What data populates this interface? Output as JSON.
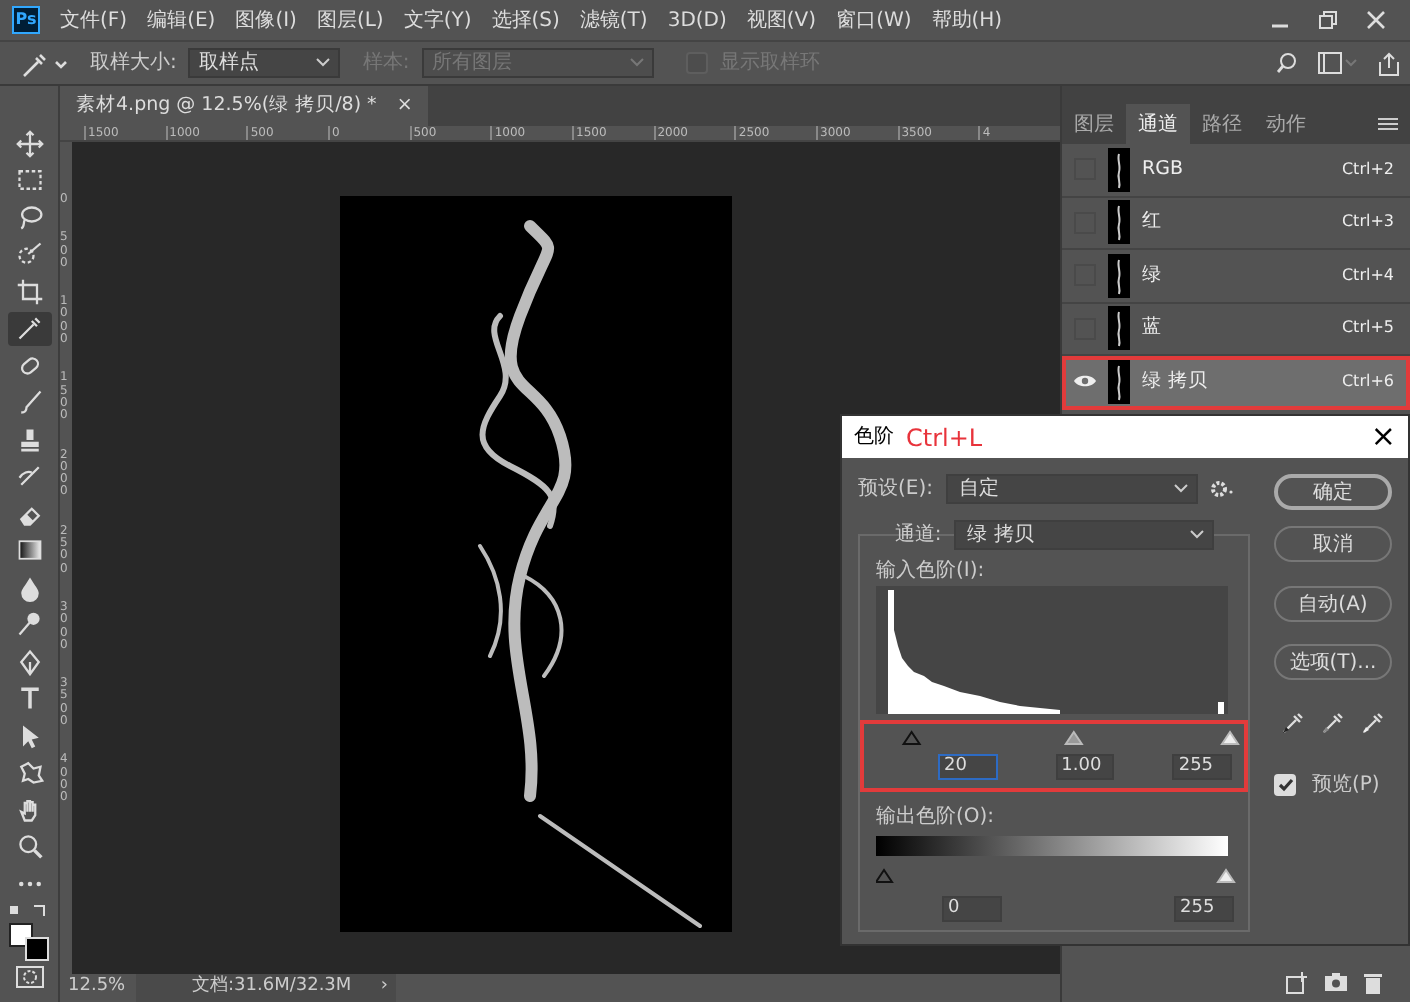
{
  "menu_bar": {
    "logo": "Ps",
    "items": [
      "文件(F)",
      "编辑(E)",
      "图像(I)",
      "图层(L)",
      "文字(Y)",
      "选择(S)",
      "滤镜(T)",
      "3D(D)",
      "视图(V)",
      "窗口(W)",
      "帮助(H)"
    ]
  },
  "options_bar": {
    "sample_size_label": "取样大小:",
    "sample_size": "取样点",
    "sample_label": "样本:",
    "sample": "所有图层",
    "sample_disabled": true,
    "ring_label": "显示取样环",
    "ring_checked": false,
    "ring_disabled": true
  },
  "document_tab": {
    "title": "素材4.png @ 12.5%(绿 拷贝/8) *",
    "close": "×"
  },
  "rulers": {
    "horizontal": [
      "1500",
      "1000",
      "500",
      "0",
      "500",
      "1000",
      "1500",
      "2000",
      "2500",
      "3000",
      "3500",
      "4"
    ],
    "vertical": [
      "0",
      "500",
      "1000",
      "1500",
      "2000",
      "2500",
      "3000",
      "3500",
      "4000"
    ]
  },
  "tools": [
    {
      "kind": "move",
      "selected": false
    },
    {
      "kind": "marquee",
      "selected": false
    },
    {
      "kind": "lasso",
      "selected": false
    },
    {
      "kind": "quick-select",
      "selected": false
    },
    {
      "kind": "crop",
      "selected": false
    },
    {
      "kind": "eyedropper",
      "selected": true
    },
    {
      "kind": "healing",
      "selected": false
    },
    {
      "kind": "brush",
      "selected": false
    },
    {
      "kind": "stamp",
      "selected": false
    },
    {
      "kind": "history-brush",
      "selected": false
    },
    {
      "kind": "eraser",
      "selected": false
    },
    {
      "kind": "gradient",
      "selected": false
    },
    {
      "kind": "blur",
      "selected": false
    },
    {
      "kind": "dodge",
      "selected": false
    },
    {
      "kind": "pen",
      "selected": false
    },
    {
      "kind": "type",
      "selected": false
    },
    {
      "kind": "path-select",
      "selected": false
    },
    {
      "kind": "shape",
      "selected": false
    },
    {
      "kind": "hand",
      "selected": false
    },
    {
      "kind": "zoom",
      "selected": false
    },
    {
      "kind": "more",
      "selected": false
    }
  ],
  "panel": {
    "tabs": [
      {
        "label": "图层",
        "selected": false
      },
      {
        "label": "通道",
        "selected": true
      },
      {
        "label": "路径",
        "selected": false
      },
      {
        "label": "动作",
        "selected": false
      }
    ],
    "channels": [
      {
        "name": "RGB",
        "shortcut": "Ctrl+2",
        "visible": false,
        "selected": false,
        "highlighted": false
      },
      {
        "name": "红",
        "shortcut": "Ctrl+3",
        "visible": false,
        "selected": false,
        "highlighted": false
      },
      {
        "name": "绿",
        "shortcut": "Ctrl+4",
        "visible": false,
        "selected": false,
        "highlighted": false
      },
      {
        "name": "蓝",
        "shortcut": "Ctrl+5",
        "visible": false,
        "selected": false,
        "highlighted": false
      },
      {
        "name": "绿 拷贝",
        "shortcut": "Ctrl+6",
        "visible": true,
        "selected": true,
        "highlighted": true
      }
    ]
  },
  "levels_dialog": {
    "title": "色阶",
    "shortcut_note": "Ctrl+L",
    "close": "×",
    "preset_label": "预设(E):",
    "preset": "自定",
    "channel_label": "通道:",
    "channel": "绿 拷贝",
    "input_label": "输入色阶(I):",
    "inputs": [
      {
        "value": "20",
        "focused": true
      },
      {
        "value": "1.00",
        "focused": false
      },
      {
        "value": "255",
        "focused": false
      }
    ],
    "inputs_highlighted": true,
    "output_label": "输出色阶(O):",
    "outputs": [
      {
        "value": "0"
      },
      {
        "value": "255"
      }
    ],
    "buttons": [
      {
        "label": "确定",
        "default": true
      },
      {
        "label": "取消",
        "default": false
      },
      {
        "label": "自动(A)",
        "default": false
      },
      {
        "label": "选项(T)...",
        "default": false
      }
    ],
    "preview_label": "预览(P)",
    "preview_checked": true
  },
  "status_bar": {
    "zoom": "12.5%",
    "doc_info": "文档:31.6M/32.3M",
    "arrow": "›"
  }
}
